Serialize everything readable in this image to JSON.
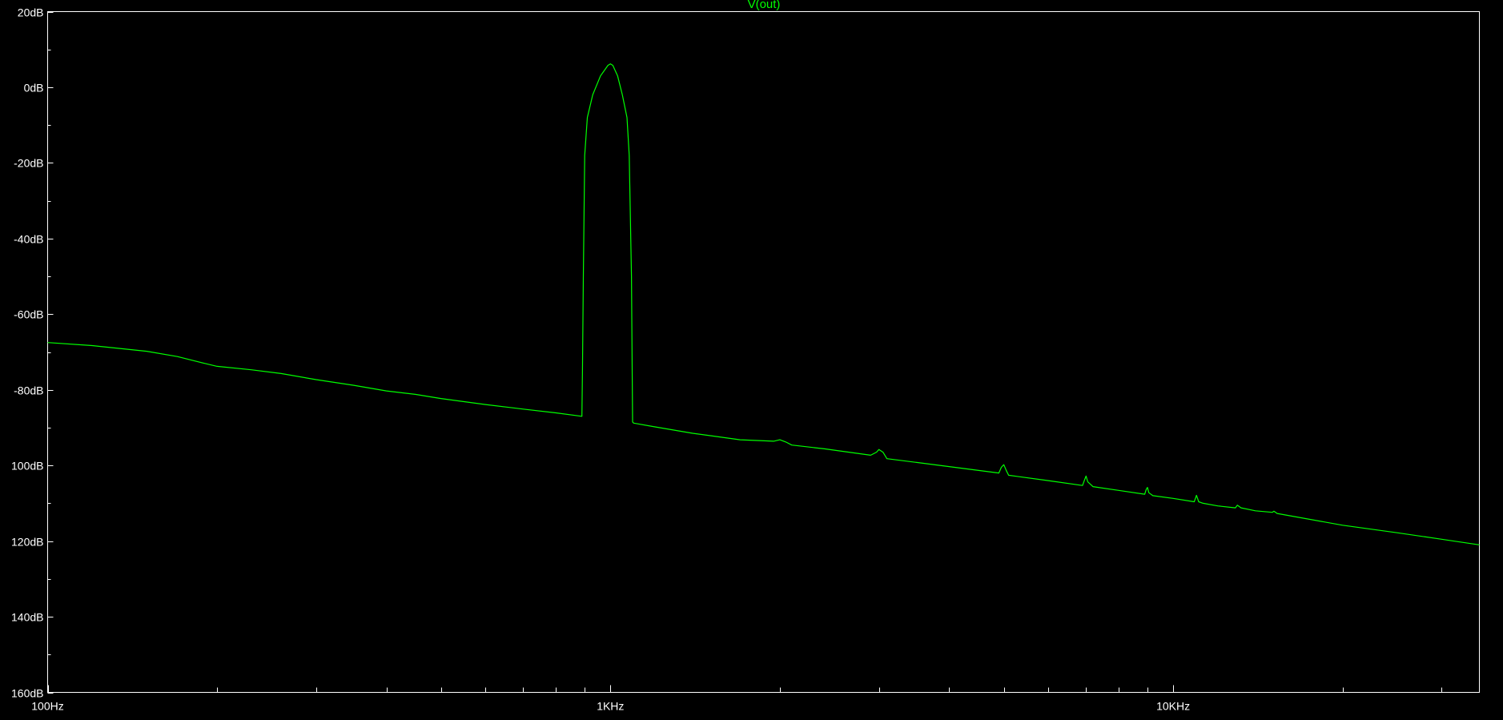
{
  "window": {
    "background": "#000000",
    "axis_color": "#ffffff",
    "text_color": "#ffffff"
  },
  "chart_data": {
    "type": "line",
    "title": "V(out)",
    "title_color": "#00ff00",
    "xscale": "log",
    "xlim": [
      100,
      35000
    ],
    "ylim": [
      -160,
      20
    ],
    "grid": false,
    "x_ticks": [
      {
        "value": 100,
        "label": "100Hz"
      },
      {
        "value": 1000,
        "label": "1KHz"
      },
      {
        "value": 10000,
        "label": "10KHz"
      }
    ],
    "y_ticks": [
      {
        "value": 20,
        "label": "20dB"
      },
      {
        "value": 0,
        "label": "0dB"
      },
      {
        "value": -20,
        "label": "-20dB"
      },
      {
        "value": -40,
        "label": "-40dB"
      },
      {
        "value": -60,
        "label": "-60dB"
      },
      {
        "value": -80,
        "label": "-80dB"
      },
      {
        "value": -100,
        "label": "100dB"
      },
      {
        "value": -120,
        "label": "120dB"
      },
      {
        "value": -140,
        "label": "140dB"
      },
      {
        "value": -160,
        "label": "160dB"
      }
    ],
    "series": [
      {
        "color": "#00ff00",
        "x": [
          100,
          120,
          150,
          170,
          190,
          200,
          230,
          260,
          300,
          350,
          400,
          450,
          500,
          600,
          700,
          800,
          890,
          892,
          895,
          900,
          910,
          930,
          960,
          990,
          1000,
          1010,
          1030,
          1050,
          1070,
          1080,
          1090,
          1093,
          1095,
          1100,
          1200,
          1400,
          1700,
          1950,
          2000,
          2050,
          2100,
          2400,
          2900,
          2970,
          3000,
          3050,
          3100,
          3500,
          4000,
          4900,
          4950,
          5000,
          5050,
          5100,
          6000,
          6900,
          6950,
          7000,
          7050,
          7200,
          8000,
          8900,
          8950,
          9000,
          9050,
          9200,
          10000,
          10900,
          11000,
          11100,
          11300,
          12000,
          12900,
          13000,
          13200,
          14000,
          15000,
          15100,
          15300,
          20000,
          25000,
          30000,
          35000
        ],
        "y": [
          -67.5,
          -68.3,
          -69.8,
          -71.2,
          -73.0,
          -73.8,
          -74.7,
          -75.7,
          -77.3,
          -78.8,
          -80.3,
          -81.2,
          -82.3,
          -83.9,
          -85.1,
          -86.1,
          -87.0,
          -75,
          -50,
          -18,
          -8,
          -2,
          3,
          5.8,
          6.2,
          5.8,
          3,
          -2,
          -8,
          -18,
          -50,
          -75,
          -88.5,
          -88.8,
          -89.8,
          -91.5,
          -93.2,
          -93.6,
          -93.2,
          -93.8,
          -94.6,
          -95.6,
          -97.3,
          -96.5,
          -95.8,
          -96.5,
          -98.2,
          -99.2,
          -100.3,
          -102.0,
          -100.5,
          -99.8,
          -101.3,
          -102.6,
          -104.0,
          -105.3,
          -104.0,
          -102.8,
          -104.3,
          -105.6,
          -106.6,
          -107.6,
          -106.4,
          -105.8,
          -107.2,
          -108.0,
          -108.7,
          -109.6,
          -107.9,
          -109.6,
          -110.0,
          -110.7,
          -111.2,
          -110.5,
          -111.2,
          -112.0,
          -112.4,
          -112.1,
          -112.7,
          -115.8,
          -117.8,
          -119.5,
          -121.0
        ]
      }
    ]
  }
}
